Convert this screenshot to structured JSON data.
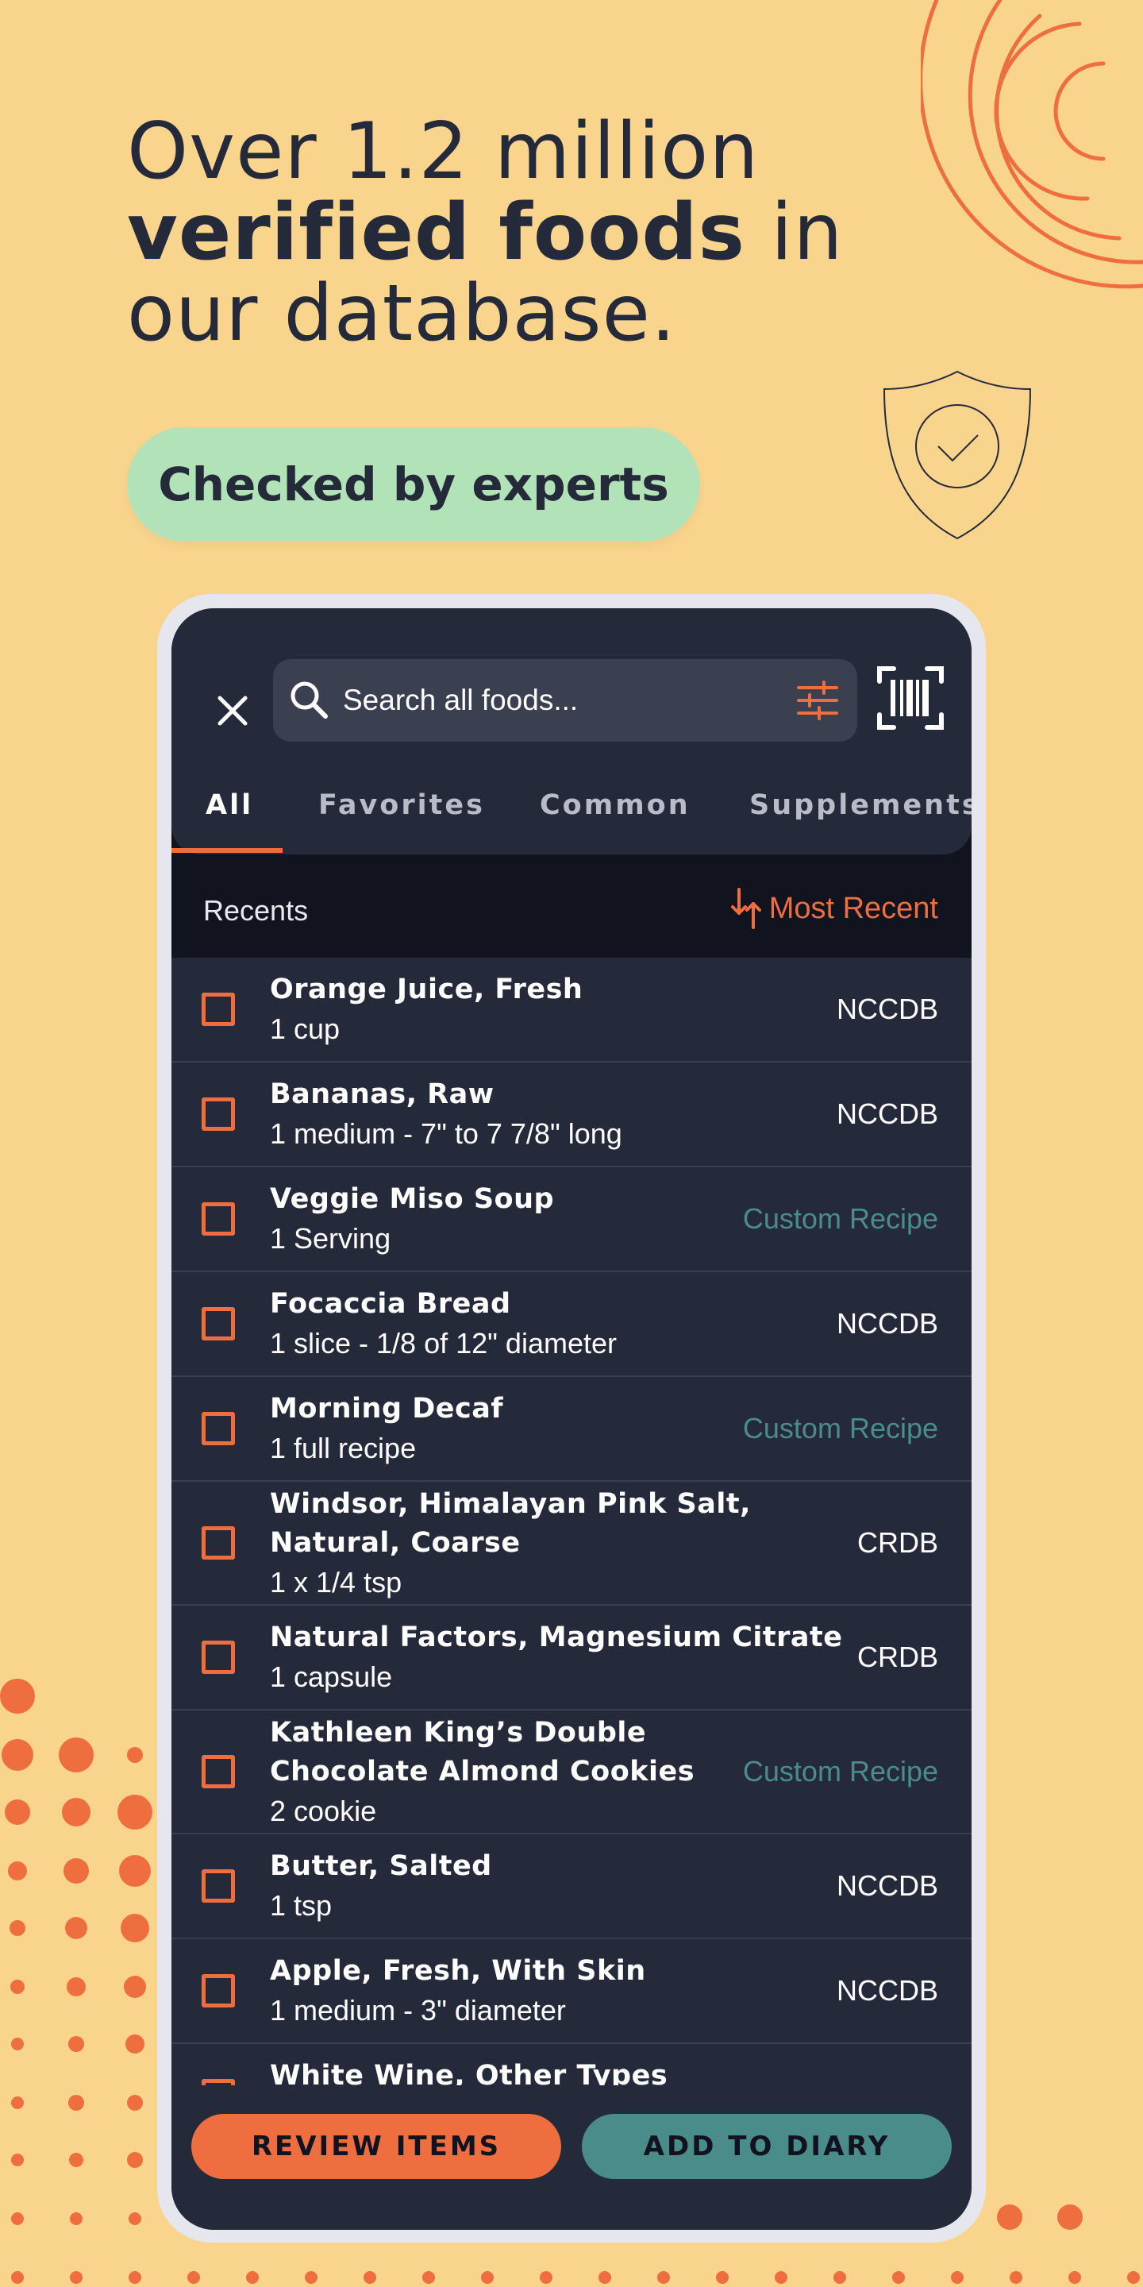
{
  "headline": {
    "line1": "Over 1.2 million",
    "line2_bold": "verified foods",
    "line2_rest": " in",
    "line3": "our database."
  },
  "badge": "Checked by experts",
  "app": {
    "search_placeholder": "Search all foods...",
    "tabs": [
      "All",
      "Favorites",
      "Common",
      "Supplements"
    ],
    "active_tab": "All",
    "section_label": "Recents",
    "sort_label": "Most Recent",
    "items": [
      {
        "name": "Orange Juice, Fresh",
        "serving": "1 cup",
        "source": "NCCDB",
        "kind": "db"
      },
      {
        "name": "Bananas, Raw",
        "serving": "1 medium - 7\" to 7 7/8\" long",
        "source": "NCCDB",
        "kind": "db"
      },
      {
        "name": "Veggie Miso Soup",
        "serving": "1 Serving",
        "source": "Custom Recipe",
        "kind": "custom"
      },
      {
        "name": "Focaccia Bread",
        "serving": "1 slice - 1/8 of 12\" diameter",
        "source": "NCCDB",
        "kind": "db"
      },
      {
        "name": "Morning Decaf",
        "serving": "1 full recipe",
        "source": "Custom Recipe",
        "kind": "custom"
      },
      {
        "name": "Windsor, Himalayan Pink Salt,",
        "name2": "Natural, Coarse",
        "serving": "1 x 1/4 tsp",
        "source": "CRDB",
        "kind": "db"
      },
      {
        "name": "Natural Factors, Magnesium Citrate",
        "serving": "1 capsule",
        "source": "CRDB",
        "kind": "db"
      },
      {
        "name": "Kathleen King’s Double",
        "name2": "Chocolate Almond Cookies",
        "serving": "2 cookie",
        "source": "Custom Recipe",
        "kind": "custom"
      },
      {
        "name": "Butter, Salted",
        "serving": "1 tsp",
        "source": "NCCDB",
        "kind": "db"
      },
      {
        "name": "Apple, Fresh, With Skin",
        "serving": "1 medium - 3\" diameter",
        "source": "NCCDB",
        "kind": "db"
      },
      {
        "name": "White Wine, Other Types",
        "serving": "",
        "source": "",
        "kind": "db"
      }
    ],
    "review_button": "REVIEW ITEMS",
    "add_button": "ADD TO DIARY"
  },
  "colors": {
    "background": "#f9d48d",
    "accent_orange": "#ee6e3f",
    "teal": "#4a8c8a",
    "badge_green": "#b2e3b8",
    "app_dark": "#11141f",
    "panel": "#252a3a"
  },
  "icons": [
    "close-icon",
    "search-icon",
    "filter-icon",
    "barcode-icon",
    "sort-icon",
    "shield-check-icon"
  ]
}
